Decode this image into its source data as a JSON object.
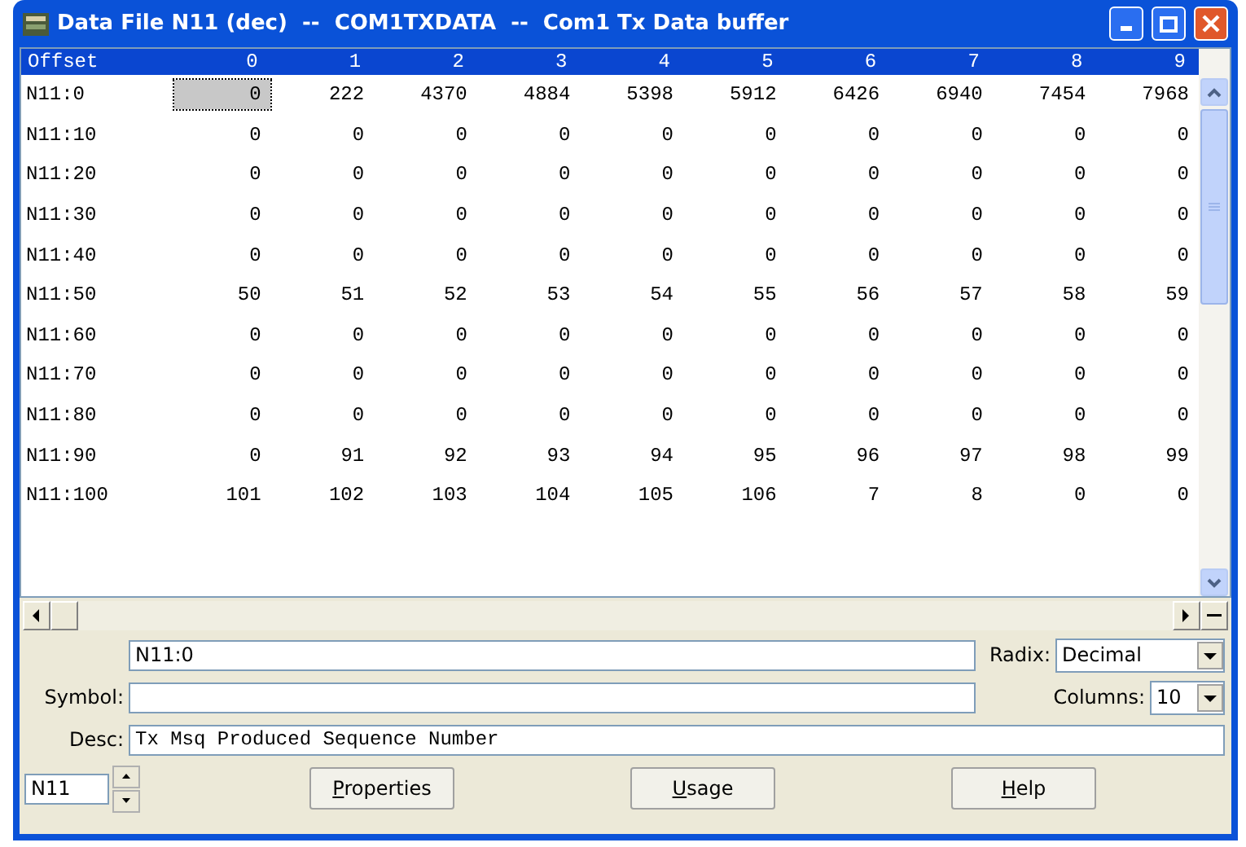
{
  "window": {
    "title": "Data File N11 (dec)  --  COM1TXDATA  --  Com1 Tx Data buffer"
  },
  "table": {
    "offset_header": "Offset",
    "columns": [
      "0",
      "1",
      "2",
      "3",
      "4",
      "5",
      "6",
      "7",
      "8",
      "9"
    ],
    "rows": [
      {
        "label": "N11:0",
        "cells": [
          {
            "value": "0",
            "selected": true
          },
          {
            "value": "222",
            "selected": false
          },
          {
            "value": "4370",
            "selected": false
          },
          {
            "value": "4884",
            "selected": false
          },
          {
            "value": "5398",
            "selected": false
          },
          {
            "value": "5912",
            "selected": false
          },
          {
            "value": "6426",
            "selected": false
          },
          {
            "value": "6940",
            "selected": false
          },
          {
            "value": "7454",
            "selected": false
          },
          {
            "value": "7968",
            "selected": false
          }
        ]
      },
      {
        "label": "N11:10",
        "cells": [
          {
            "value": "0",
            "selected": false
          },
          {
            "value": "0",
            "selected": false
          },
          {
            "value": "0",
            "selected": false
          },
          {
            "value": "0",
            "selected": false
          },
          {
            "value": "0",
            "selected": false
          },
          {
            "value": "0",
            "selected": false
          },
          {
            "value": "0",
            "selected": false
          },
          {
            "value": "0",
            "selected": false
          },
          {
            "value": "0",
            "selected": false
          },
          {
            "value": "0",
            "selected": false
          }
        ]
      },
      {
        "label": "N11:20",
        "cells": [
          {
            "value": "0",
            "selected": false
          },
          {
            "value": "0",
            "selected": false
          },
          {
            "value": "0",
            "selected": false
          },
          {
            "value": "0",
            "selected": false
          },
          {
            "value": "0",
            "selected": false
          },
          {
            "value": "0",
            "selected": false
          },
          {
            "value": "0",
            "selected": false
          },
          {
            "value": "0",
            "selected": false
          },
          {
            "value": "0",
            "selected": false
          },
          {
            "value": "0",
            "selected": false
          }
        ]
      },
      {
        "label": "N11:30",
        "cells": [
          {
            "value": "0",
            "selected": false
          },
          {
            "value": "0",
            "selected": false
          },
          {
            "value": "0",
            "selected": false
          },
          {
            "value": "0",
            "selected": false
          },
          {
            "value": "0",
            "selected": false
          },
          {
            "value": "0",
            "selected": false
          },
          {
            "value": "0",
            "selected": false
          },
          {
            "value": "0",
            "selected": false
          },
          {
            "value": "0",
            "selected": false
          },
          {
            "value": "0",
            "selected": false
          }
        ]
      },
      {
        "label": "N11:40",
        "cells": [
          {
            "value": "0",
            "selected": false
          },
          {
            "value": "0",
            "selected": false
          },
          {
            "value": "0",
            "selected": false
          },
          {
            "value": "0",
            "selected": false
          },
          {
            "value": "0",
            "selected": false
          },
          {
            "value": "0",
            "selected": false
          },
          {
            "value": "0",
            "selected": false
          },
          {
            "value": "0",
            "selected": false
          },
          {
            "value": "0",
            "selected": false
          },
          {
            "value": "0",
            "selected": false
          }
        ]
      },
      {
        "label": "N11:50",
        "cells": [
          {
            "value": "50",
            "selected": false
          },
          {
            "value": "51",
            "selected": false
          },
          {
            "value": "52",
            "selected": false
          },
          {
            "value": "53",
            "selected": false
          },
          {
            "value": "54",
            "selected": false
          },
          {
            "value": "55",
            "selected": false
          },
          {
            "value": "56",
            "selected": false
          },
          {
            "value": "57",
            "selected": false
          },
          {
            "value": "58",
            "selected": false
          },
          {
            "value": "59",
            "selected": false
          }
        ]
      },
      {
        "label": "N11:60",
        "cells": [
          {
            "value": "0",
            "selected": false
          },
          {
            "value": "0",
            "selected": false
          },
          {
            "value": "0",
            "selected": false
          },
          {
            "value": "0",
            "selected": false
          },
          {
            "value": "0",
            "selected": false
          },
          {
            "value": "0",
            "selected": false
          },
          {
            "value": "0",
            "selected": false
          },
          {
            "value": "0",
            "selected": false
          },
          {
            "value": "0",
            "selected": false
          },
          {
            "value": "0",
            "selected": false
          }
        ]
      },
      {
        "label": "N11:70",
        "cells": [
          {
            "value": "0",
            "selected": false
          },
          {
            "value": "0",
            "selected": false
          },
          {
            "value": "0",
            "selected": false
          },
          {
            "value": "0",
            "selected": false
          },
          {
            "value": "0",
            "selected": false
          },
          {
            "value": "0",
            "selected": false
          },
          {
            "value": "0",
            "selected": false
          },
          {
            "value": "0",
            "selected": false
          },
          {
            "value": "0",
            "selected": false
          },
          {
            "value": "0",
            "selected": false
          }
        ]
      },
      {
        "label": "N11:80",
        "cells": [
          {
            "value": "0",
            "selected": false
          },
          {
            "value": "0",
            "selected": false
          },
          {
            "value": "0",
            "selected": false
          },
          {
            "value": "0",
            "selected": false
          },
          {
            "value": "0",
            "selected": false
          },
          {
            "value": "0",
            "selected": false
          },
          {
            "value": "0",
            "selected": false
          },
          {
            "value": "0",
            "selected": false
          },
          {
            "value": "0",
            "selected": false
          },
          {
            "value": "0",
            "selected": false
          }
        ]
      },
      {
        "label": "N11:90",
        "cells": [
          {
            "value": "0",
            "selected": false
          },
          {
            "value": "91",
            "selected": false
          },
          {
            "value": "92",
            "selected": false
          },
          {
            "value": "93",
            "selected": false
          },
          {
            "value": "94",
            "selected": false
          },
          {
            "value": "95",
            "selected": false
          },
          {
            "value": "96",
            "selected": false
          },
          {
            "value": "97",
            "selected": false
          },
          {
            "value": "98",
            "selected": false
          },
          {
            "value": "99",
            "selected": false
          }
        ]
      },
      {
        "label": "N11:100",
        "cells": [
          {
            "value": "101",
            "selected": false
          },
          {
            "value": "102",
            "selected": false
          },
          {
            "value": "103",
            "selected": false
          },
          {
            "value": "104",
            "selected": false
          },
          {
            "value": "105",
            "selected": false
          },
          {
            "value": "106",
            "selected": false
          },
          {
            "value": "7",
            "selected": false
          },
          {
            "value": "8",
            "selected": false
          },
          {
            "value": "0",
            "selected": false
          },
          {
            "value": "0",
            "selected": false
          }
        ]
      }
    ]
  },
  "address": {
    "value": "N11:0"
  },
  "radix": {
    "label": "Radix:",
    "value": "Decimal"
  },
  "symbol": {
    "label": "Symbol:"
  },
  "columns_select": {
    "label": "Columns:",
    "value": "10"
  },
  "desc": {
    "label": "Desc:",
    "value": "Tx Msq Produced Sequence Number"
  },
  "file_spinner": {
    "value": "N11"
  },
  "buttons": [
    {
      "label": "Properties"
    },
    {
      "label": "Usage"
    },
    {
      "label": "Help"
    }
  ]
}
